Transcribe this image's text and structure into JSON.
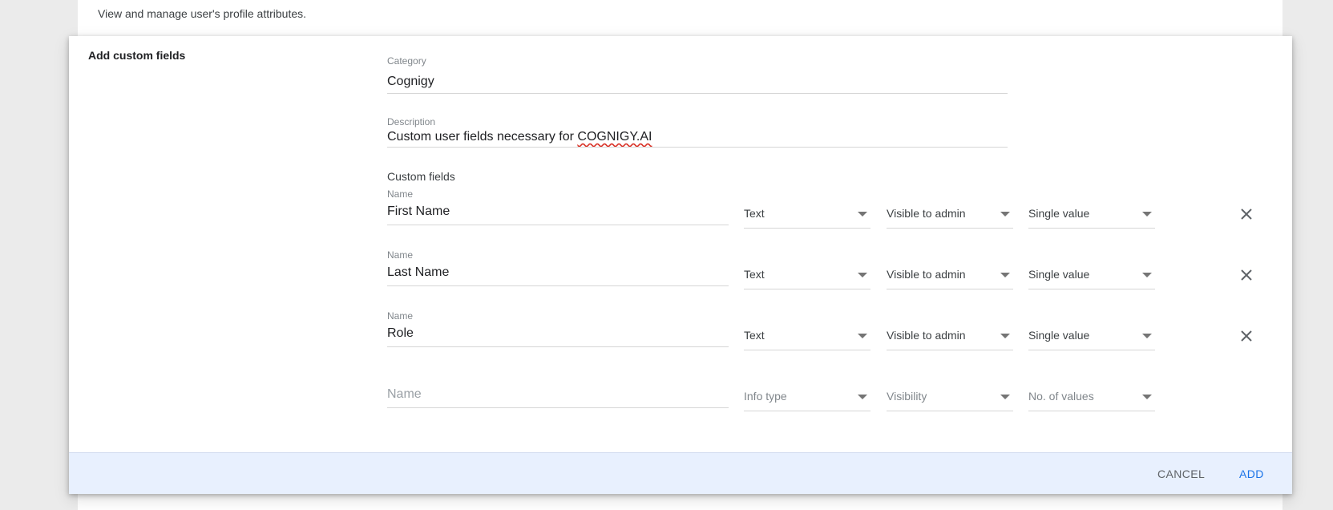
{
  "page": {
    "description": "View and manage user's profile attributes."
  },
  "dialog": {
    "title": "Add custom fields",
    "category": {
      "label": "Category",
      "value": "Cognigy"
    },
    "description": {
      "label": "Description",
      "value_prefix": "Custom user fields necessary for ",
      "value_misspelled": "COGNIGY.AI"
    },
    "custom_fields_title": "Custom fields",
    "fields": [
      {
        "name_label": "Name",
        "name": "First Name",
        "info_type": "Text",
        "visibility": "Visible to admin",
        "num_values": "Single value"
      },
      {
        "name_label": "Name",
        "name": "Last Name",
        "info_type": "Text",
        "visibility": "Visible to admin",
        "num_values": "Single value"
      },
      {
        "name_label": "Name",
        "name": "Role",
        "info_type": "Text",
        "visibility": "Visible to admin",
        "num_values": "Single value"
      }
    ],
    "new_field": {
      "name_placeholder": "Name",
      "info_type_placeholder": "Info type",
      "visibility_placeholder": "Visibility",
      "num_values_placeholder": "No. of values"
    },
    "footer": {
      "cancel_label": "CANCEL",
      "add_label": "ADD"
    }
  },
  "icons": {
    "remove": "close-icon",
    "dropdown": "triangle-down-icon"
  },
  "colors": {
    "accent": "#1a73e8",
    "footer_bg": "#e8f0fe",
    "page_bg": "#ebebeb"
  }
}
